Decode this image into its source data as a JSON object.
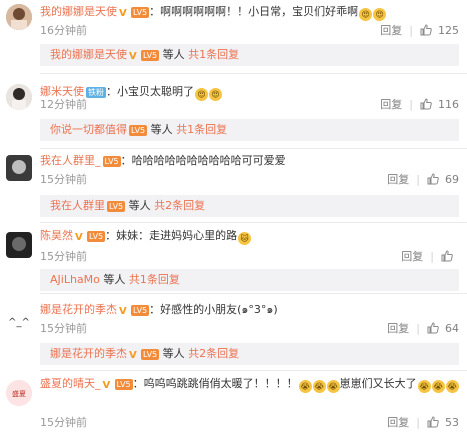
{
  "comments": [
    {
      "user": "我的娜娜是天使",
      "verified": true,
      "level": "⚥",
      "level_text": "5",
      "fan_badge": "",
      "text": "啊啊啊啊啊啊！！小日常，宝贝们好乖啊",
      "emojis": [
        "😍",
        "😍"
      ],
      "time": "16分钟前",
      "reply": "回复",
      "likes": "125",
      "sub": {
        "user": "我的娜娜是天使",
        "suffix": "等人",
        "count": "共1条回复"
      }
    },
    {
      "user": "娜米天使",
      "verified": false,
      "fan_badge": "铁粉",
      "text": "小宝贝太聪明了",
      "emojis": [
        "😍",
        "😍"
      ],
      "time": "12分钟前",
      "reply": "回复",
      "likes": "116",
      "sub": {
        "user": "你说一切都值得",
        "suffix": "等人",
        "count": "共1条回复"
      }
    },
    {
      "user": "我在人群里_",
      "verified": false,
      "fan_badge": "",
      "text": "哈哈哈哈哈哈哈哈哈哈可可爱爱",
      "emojis": [],
      "time": "15分钟前",
      "reply": "回复",
      "likes": "69",
      "sub": {
        "user": "我在人群里",
        "suffix": "等人",
        "count": "共2条回复"
      }
    },
    {
      "user": "陈昊然",
      "verified": true,
      "fan_badge": "",
      "text": "妹妹：走进妈妈心里的路",
      "emojis": [
        "🐱"
      ],
      "time": "15分钟前",
      "reply": "回复",
      "likes": "",
      "sub": {
        "user": "AJiLhaMo",
        "suffix": "等人",
        "count": "共1条回复"
      }
    },
    {
      "user": "娜是花开的季杰",
      "verified": true,
      "fan_badge": "",
      "text": "好感性的小朋友(๑°3°๑)",
      "emojis": [],
      "time": "15分钟前",
      "reply": "回复",
      "likes": "64",
      "sub": {
        "user": "娜是花开的季杰",
        "suffix": "等人",
        "count": "共2条回复"
      }
    },
    {
      "user": "盛夏的晴天_",
      "verified": true,
      "fan_badge": "",
      "text": "呜呜呜跳跳俏俏太暖了！！！！",
      "text2": "崽崽们又长大了",
      "emojis": [
        "😭",
        "😭",
        "😭"
      ],
      "emojis2": [
        "😭",
        "😭",
        "😭"
      ],
      "time": "15分钟前",
      "reply": "回复",
      "likes": "53"
    }
  ],
  "colors": {
    "accent": "#eb7350",
    "muted": "#999999",
    "subbar_bg": "#f2f2f5"
  }
}
